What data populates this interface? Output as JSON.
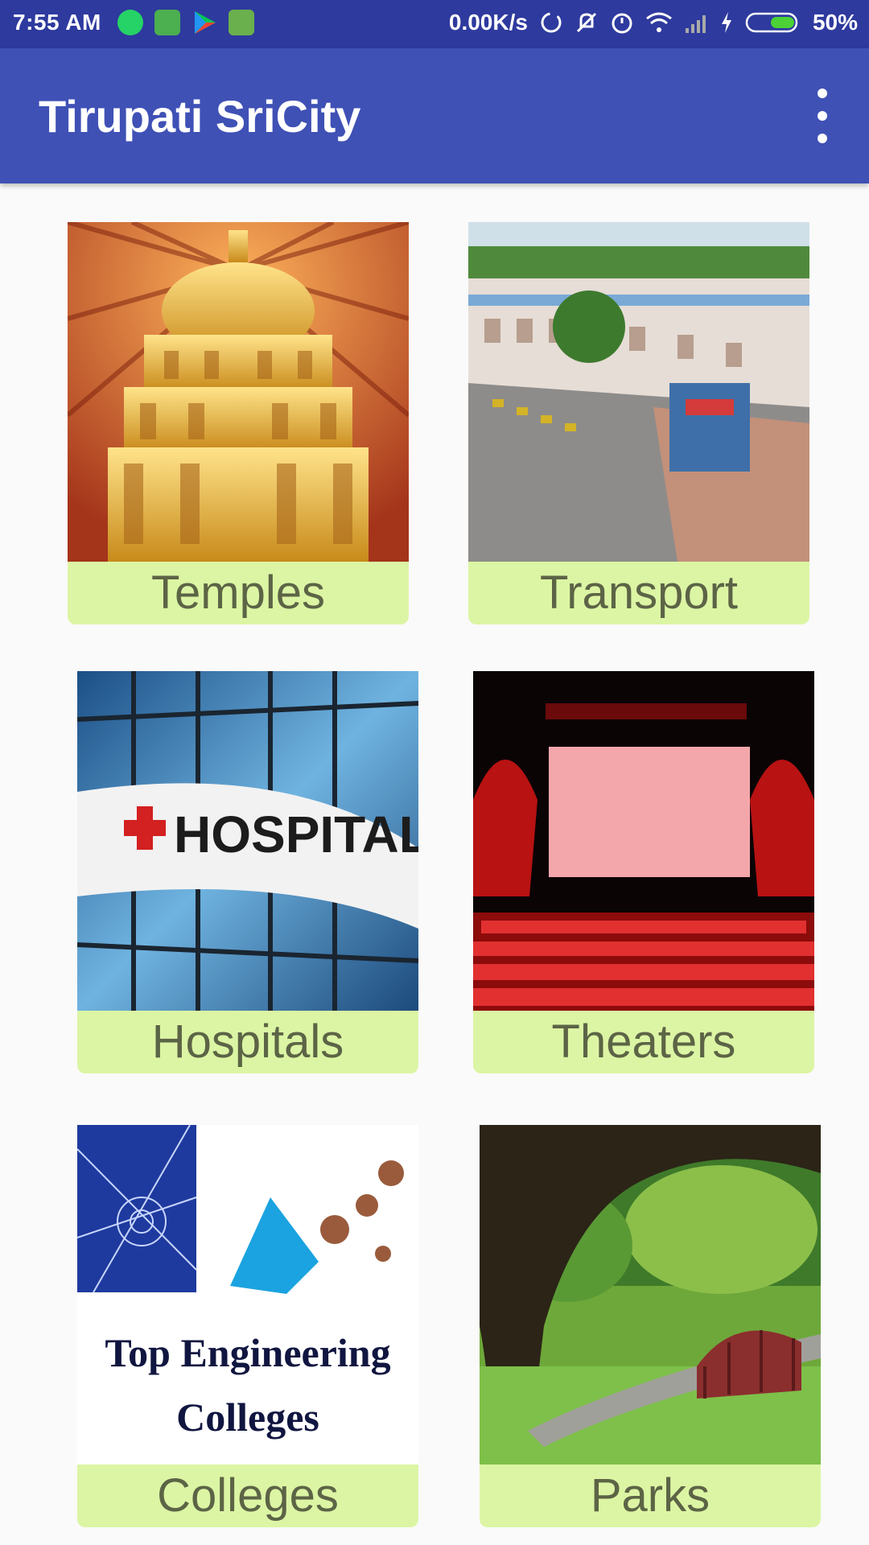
{
  "status_bar": {
    "time": "7:55 AM",
    "network_speed": "0.00K/s",
    "battery": "50%",
    "icons": [
      "whatsapp-icon",
      "battery-saver-icon",
      "play-store-icon",
      "android-icon",
      "sync-icon",
      "mute-icon",
      "alarm-icon",
      "wifi-icon",
      "signal-icon",
      "charging-icon",
      "battery-icon"
    ]
  },
  "app_bar": {
    "title": "Tirupati SriCity",
    "menu_icon": "overflow-menu-icon"
  },
  "tiles": [
    {
      "label": "Temples",
      "image": "temple-gopuram-image"
    },
    {
      "label": "Transport",
      "image": "railway-station-image"
    },
    {
      "label": "Hospitals",
      "image": "hospital-building-image",
      "image_text": "HOSPITAL"
    },
    {
      "label": "Theaters",
      "image": "cinema-theater-image"
    },
    {
      "label": "Colleges",
      "image": "engineering-colleges-image",
      "image_text_line1": "Top Engineering",
      "image_text_line2": "Colleges"
    },
    {
      "label": "Parks",
      "image": "park-bridge-image"
    }
  ],
  "colors": {
    "status_bar": "#2e3a9e",
    "app_bar": "#3f51b5",
    "label_background": "#dcf5a4",
    "label_text": "#5c6446"
  }
}
